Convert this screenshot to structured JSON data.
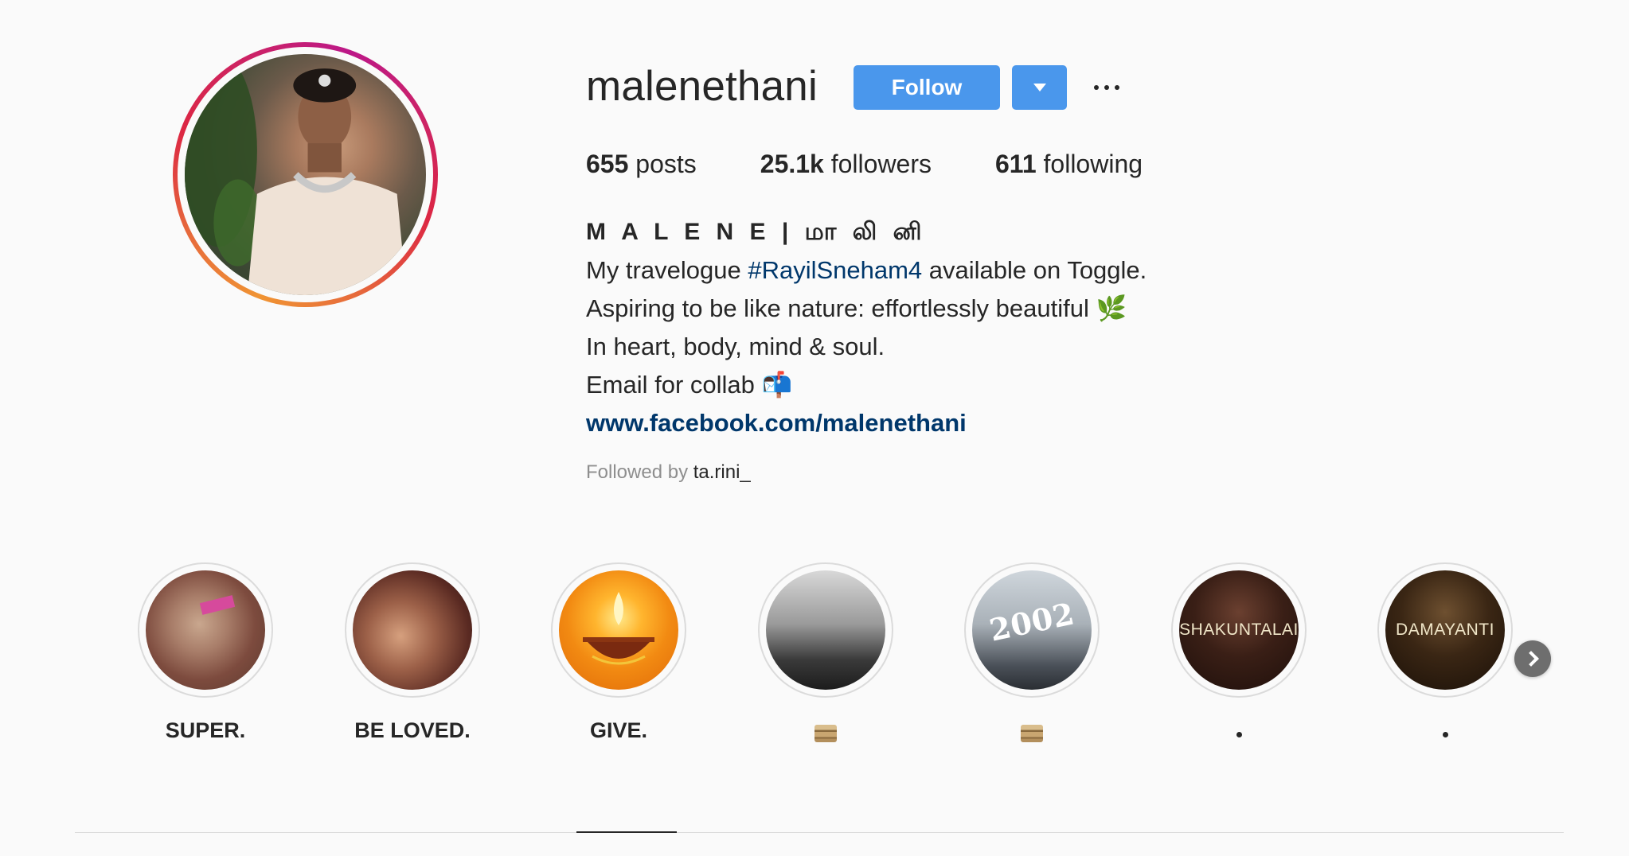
{
  "profile": {
    "username": "malenethani",
    "follow_label": "Follow",
    "stats": {
      "posts_count": "655",
      "posts_label": "posts",
      "followers_count": "25.1k",
      "followers_label": "followers",
      "following_count": "611",
      "following_label": "following"
    },
    "bio": {
      "display_name": "M A L E N E | மா லி னி",
      "line1_prefix": "My travelogue ",
      "line1_hashtag": "#RayilSneham4",
      "line1_suffix": " available on Toggle.",
      "line2": "Aspiring to be like nature: effortlessly beautiful 🌿",
      "line3": "In heart, body, mind & soul.",
      "line4": "Email for collab 📬",
      "website": "www.facebook.com/malenethani"
    },
    "followed_by_label": "Followed by",
    "followed_by_user": "ta.rini_"
  },
  "highlights": [
    {
      "label": "SUPER.",
      "overlay": ""
    },
    {
      "label": "BE LOVED.",
      "overlay": ""
    },
    {
      "label": "GIVE.",
      "overlay": ""
    },
    {
      "label": "",
      "overlay": "",
      "label_icon": "box-icon"
    },
    {
      "label": "",
      "overlay": "2002",
      "label_icon": "box-icon"
    },
    {
      "label": "",
      "overlay": "SHAKUNTALAI",
      "label_icon": "dot-icon"
    },
    {
      "label": "",
      "overlay": "DAMAYANTI",
      "label_icon": "dot-icon"
    }
  ],
  "colors": {
    "accent": "#4a97ec",
    "link": "#00376b",
    "muted": "#8e8e8e"
  }
}
